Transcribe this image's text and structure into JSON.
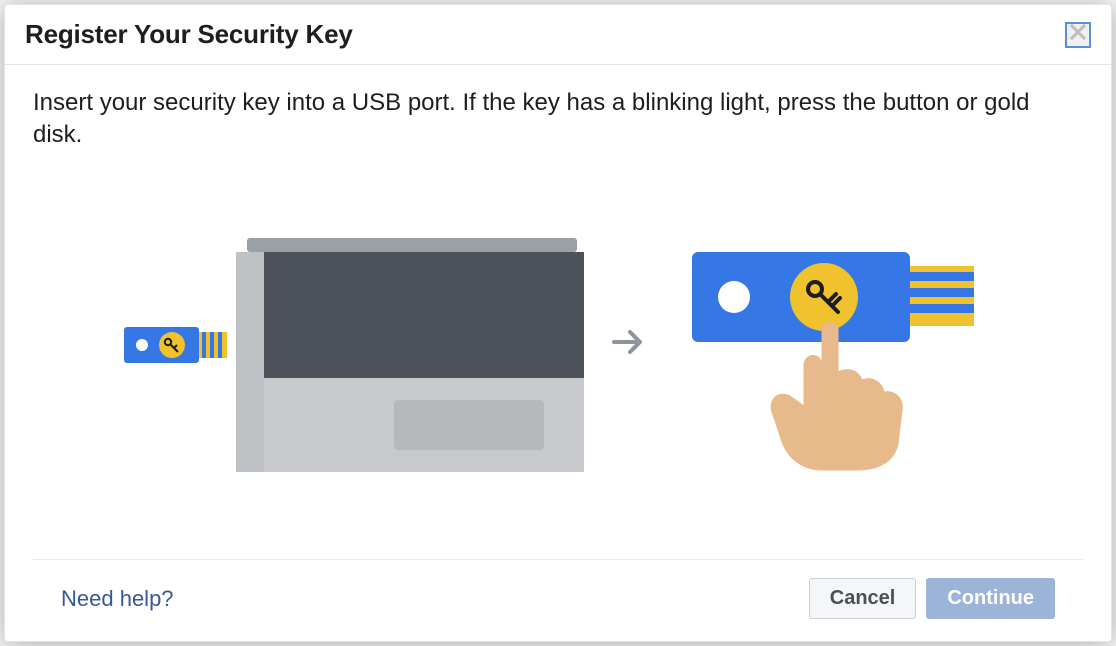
{
  "dialog": {
    "title": "Register Your Security Key",
    "instruction": "Insert your security key into a USB port. If the key has a blinking light, press the button or gold disk."
  },
  "footer": {
    "help_link": "Need help?",
    "cancel_label": "Cancel",
    "continue_label": "Continue"
  }
}
